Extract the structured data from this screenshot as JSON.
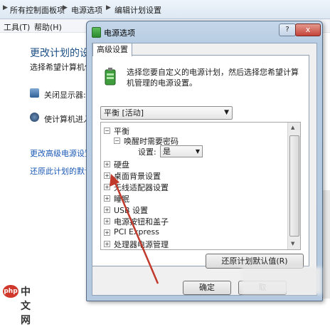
{
  "breadcrumb": {
    "items": [
      "所有控制面板项",
      "电源选项",
      "编辑计划设置"
    ]
  },
  "menu": {
    "items": [
      "工具(T)",
      "帮助(H)"
    ]
  },
  "background": {
    "title": "更改计划的设",
    "subtitle": "选择希望计算机使",
    "display_label": "关闭显示器:",
    "sleep_label": "使计算机进入",
    "advanced_link": "更改高级电源设置",
    "restore_link": "还原此计划的默认"
  },
  "dialog": {
    "title": "电源选项",
    "help_button": "?",
    "close_button": "x",
    "tab_label": "高级设置",
    "description": "选择您要自定义的电源计划，然后选择您希望计算机管理的电源设置。",
    "plan_select_value": "平衡 [活动]",
    "tree": {
      "root": "平衡",
      "wake_password": "唤醒时需要密码",
      "setting_label": "设置:",
      "setting_value": "是",
      "items": [
        "硬盘",
        "桌面背景设置",
        "无线适配器设置",
        "睡眠",
        "USB 设置",
        "电源按钮和盖子",
        "PCI Express",
        "处理器电源管理"
      ]
    },
    "restore_button": "还原计划默认值(R)",
    "ok_button": "确定",
    "cancel_button": "取"
  },
  "watermark": {
    "logo": "php",
    "text": "中文网"
  },
  "colors": {
    "accent_arrow": "#c0392b",
    "link": "#1a58b5"
  }
}
